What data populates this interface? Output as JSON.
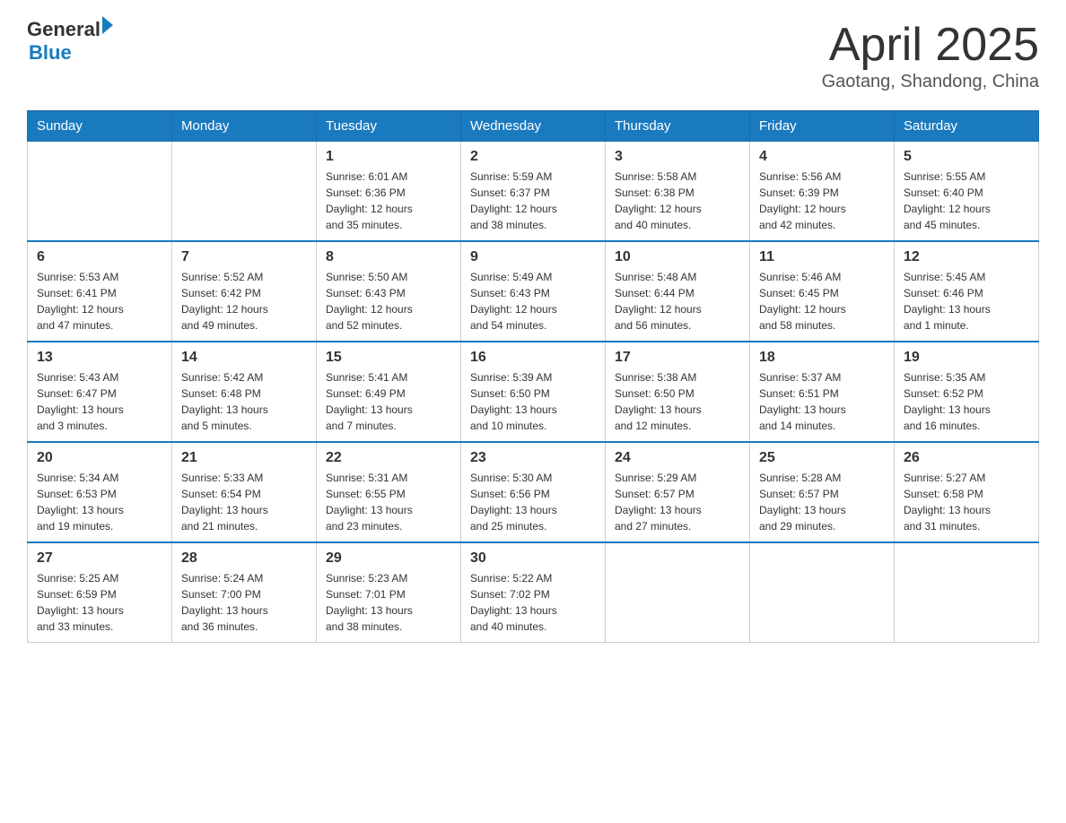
{
  "header": {
    "logo_general": "General",
    "logo_blue": "Blue",
    "month_title": "April 2025",
    "location": "Gaotang, Shandong, China"
  },
  "days_of_week": [
    "Sunday",
    "Monday",
    "Tuesday",
    "Wednesday",
    "Thursday",
    "Friday",
    "Saturday"
  ],
  "weeks": [
    [
      {
        "day": "",
        "info": ""
      },
      {
        "day": "",
        "info": ""
      },
      {
        "day": "1",
        "info": "Sunrise: 6:01 AM\nSunset: 6:36 PM\nDaylight: 12 hours\nand 35 minutes."
      },
      {
        "day": "2",
        "info": "Sunrise: 5:59 AM\nSunset: 6:37 PM\nDaylight: 12 hours\nand 38 minutes."
      },
      {
        "day": "3",
        "info": "Sunrise: 5:58 AM\nSunset: 6:38 PM\nDaylight: 12 hours\nand 40 minutes."
      },
      {
        "day": "4",
        "info": "Sunrise: 5:56 AM\nSunset: 6:39 PM\nDaylight: 12 hours\nand 42 minutes."
      },
      {
        "day": "5",
        "info": "Sunrise: 5:55 AM\nSunset: 6:40 PM\nDaylight: 12 hours\nand 45 minutes."
      }
    ],
    [
      {
        "day": "6",
        "info": "Sunrise: 5:53 AM\nSunset: 6:41 PM\nDaylight: 12 hours\nand 47 minutes."
      },
      {
        "day": "7",
        "info": "Sunrise: 5:52 AM\nSunset: 6:42 PM\nDaylight: 12 hours\nand 49 minutes."
      },
      {
        "day": "8",
        "info": "Sunrise: 5:50 AM\nSunset: 6:43 PM\nDaylight: 12 hours\nand 52 minutes."
      },
      {
        "day": "9",
        "info": "Sunrise: 5:49 AM\nSunset: 6:43 PM\nDaylight: 12 hours\nand 54 minutes."
      },
      {
        "day": "10",
        "info": "Sunrise: 5:48 AM\nSunset: 6:44 PM\nDaylight: 12 hours\nand 56 minutes."
      },
      {
        "day": "11",
        "info": "Sunrise: 5:46 AM\nSunset: 6:45 PM\nDaylight: 12 hours\nand 58 minutes."
      },
      {
        "day": "12",
        "info": "Sunrise: 5:45 AM\nSunset: 6:46 PM\nDaylight: 13 hours\nand 1 minute."
      }
    ],
    [
      {
        "day": "13",
        "info": "Sunrise: 5:43 AM\nSunset: 6:47 PM\nDaylight: 13 hours\nand 3 minutes."
      },
      {
        "day": "14",
        "info": "Sunrise: 5:42 AM\nSunset: 6:48 PM\nDaylight: 13 hours\nand 5 minutes."
      },
      {
        "day": "15",
        "info": "Sunrise: 5:41 AM\nSunset: 6:49 PM\nDaylight: 13 hours\nand 7 minutes."
      },
      {
        "day": "16",
        "info": "Sunrise: 5:39 AM\nSunset: 6:50 PM\nDaylight: 13 hours\nand 10 minutes."
      },
      {
        "day": "17",
        "info": "Sunrise: 5:38 AM\nSunset: 6:50 PM\nDaylight: 13 hours\nand 12 minutes."
      },
      {
        "day": "18",
        "info": "Sunrise: 5:37 AM\nSunset: 6:51 PM\nDaylight: 13 hours\nand 14 minutes."
      },
      {
        "day": "19",
        "info": "Sunrise: 5:35 AM\nSunset: 6:52 PM\nDaylight: 13 hours\nand 16 minutes."
      }
    ],
    [
      {
        "day": "20",
        "info": "Sunrise: 5:34 AM\nSunset: 6:53 PM\nDaylight: 13 hours\nand 19 minutes."
      },
      {
        "day": "21",
        "info": "Sunrise: 5:33 AM\nSunset: 6:54 PM\nDaylight: 13 hours\nand 21 minutes."
      },
      {
        "day": "22",
        "info": "Sunrise: 5:31 AM\nSunset: 6:55 PM\nDaylight: 13 hours\nand 23 minutes."
      },
      {
        "day": "23",
        "info": "Sunrise: 5:30 AM\nSunset: 6:56 PM\nDaylight: 13 hours\nand 25 minutes."
      },
      {
        "day": "24",
        "info": "Sunrise: 5:29 AM\nSunset: 6:57 PM\nDaylight: 13 hours\nand 27 minutes."
      },
      {
        "day": "25",
        "info": "Sunrise: 5:28 AM\nSunset: 6:57 PM\nDaylight: 13 hours\nand 29 minutes."
      },
      {
        "day": "26",
        "info": "Sunrise: 5:27 AM\nSunset: 6:58 PM\nDaylight: 13 hours\nand 31 minutes."
      }
    ],
    [
      {
        "day": "27",
        "info": "Sunrise: 5:25 AM\nSunset: 6:59 PM\nDaylight: 13 hours\nand 33 minutes."
      },
      {
        "day": "28",
        "info": "Sunrise: 5:24 AM\nSunset: 7:00 PM\nDaylight: 13 hours\nand 36 minutes."
      },
      {
        "day": "29",
        "info": "Sunrise: 5:23 AM\nSunset: 7:01 PM\nDaylight: 13 hours\nand 38 minutes."
      },
      {
        "day": "30",
        "info": "Sunrise: 5:22 AM\nSunset: 7:02 PM\nDaylight: 13 hours\nand 40 minutes."
      },
      {
        "day": "",
        "info": ""
      },
      {
        "day": "",
        "info": ""
      },
      {
        "day": "",
        "info": ""
      }
    ]
  ]
}
